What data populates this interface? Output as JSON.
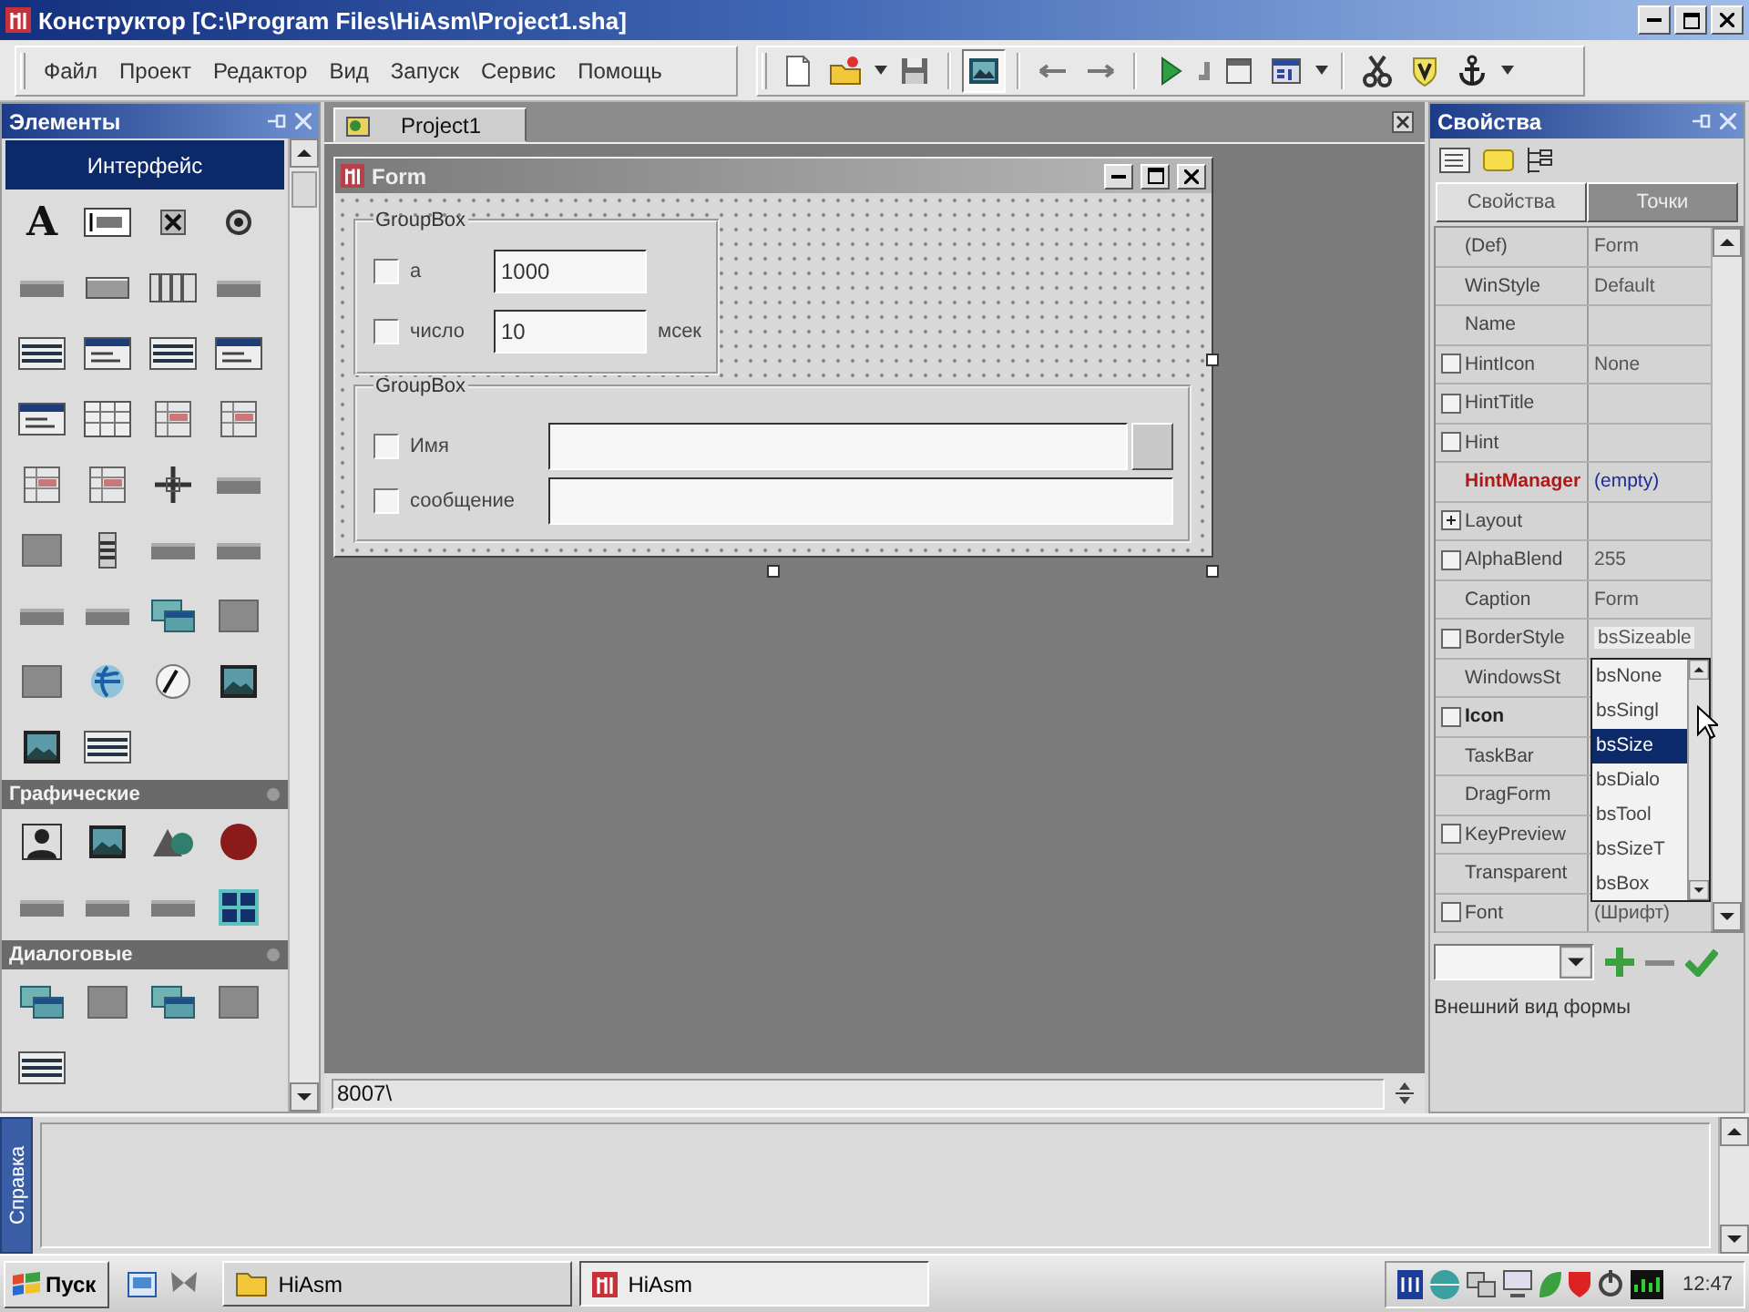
{
  "window": {
    "title": "Конструктор [C:\\Program Files\\HiAsm\\Project1.sha]"
  },
  "menu": [
    "Файл",
    "Проект",
    "Редактор",
    "Вид",
    "Запуск",
    "Сервис",
    "Помощь"
  ],
  "toolbar": [
    {
      "kind": "page",
      "pressed": false
    },
    {
      "kind": "folder",
      "pressed": false
    },
    {
      "kind": "caret",
      "pressed": false
    },
    {
      "kind": "disk",
      "pressed": false
    },
    {
      "kind": "separator"
    },
    {
      "kind": "picture",
      "pressed": true
    },
    {
      "kind": "separator"
    },
    {
      "kind": "leftarrow",
      "pressed": false
    },
    {
      "kind": "rightarrow",
      "pressed": false
    },
    {
      "kind": "separator"
    },
    {
      "kind": "play",
      "pressed": false
    },
    {
      "kind": "stub",
      "pressed": false
    },
    {
      "kind": "form",
      "pressed": false
    },
    {
      "kind": "chart",
      "pressed": false
    },
    {
      "kind": "caret",
      "pressed": false
    },
    {
      "kind": "separator"
    },
    {
      "kind": "scissors",
      "pressed": false
    },
    {
      "kind": "shield",
      "pressed": false
    },
    {
      "kind": "anchor",
      "pressed": false
    },
    {
      "kind": "caret",
      "pressed": false
    }
  ],
  "palette": {
    "title": "Элементы",
    "sections": [
      {
        "title": "Интерфейс",
        "selected": true,
        "items": [
          {
            "kind": "label",
            "glyph": "A"
          },
          {
            "kind": "textbox"
          },
          {
            "kind": "crossbox"
          },
          {
            "kind": "radio"
          },
          {
            "kind": "bar"
          },
          {
            "kind": "button"
          },
          {
            "kind": "columns"
          },
          {
            "kind": "bar"
          },
          {
            "kind": "list"
          },
          {
            "kind": "panel"
          },
          {
            "kind": "list"
          },
          {
            "kind": "panel"
          },
          {
            "kind": "panel"
          },
          {
            "kind": "grid"
          },
          {
            "kind": "table"
          },
          {
            "kind": "table"
          },
          {
            "kind": "table"
          },
          {
            "kind": "table"
          },
          {
            "kind": "crosshair"
          },
          {
            "kind": "bar"
          },
          {
            "kind": "square"
          },
          {
            "kind": "slider"
          },
          {
            "kind": "bar"
          },
          {
            "kind": "bar"
          },
          {
            "kind": "bar"
          },
          {
            "kind": "bar"
          },
          {
            "kind": "windows"
          },
          {
            "kind": "square"
          },
          {
            "kind": "square"
          },
          {
            "kind": "globe"
          },
          {
            "kind": "gauge"
          },
          {
            "kind": "picture"
          },
          {
            "kind": "picture"
          },
          {
            "kind": "list"
          }
        ]
      },
      {
        "title": "Графические",
        "selected": false,
        "items": [
          {
            "kind": "person"
          },
          {
            "kind": "picture"
          },
          {
            "kind": "shapes"
          },
          {
            "kind": "circle"
          },
          {
            "kind": "bar"
          },
          {
            "kind": "bar"
          },
          {
            "kind": "bar"
          },
          {
            "kind": "tiles"
          }
        ]
      },
      {
        "title": "Диалоговые",
        "selected": false,
        "items": [
          {
            "kind": "windows"
          },
          {
            "kind": "square"
          },
          {
            "kind": "windows"
          },
          {
            "kind": "square"
          },
          {
            "kind": "list"
          }
        ]
      }
    ]
  },
  "editor": {
    "tabs": [
      {
        "label": "Project1",
        "selected": true
      }
    ],
    "form": {
      "title": "Form",
      "groups": [
        {
          "title": "GroupBox",
          "rows": [
            {
              "kind": "text",
              "label": "а",
              "value": "1000",
              "checked": false
            },
            {
              "kind": "text",
              "label": "число",
              "value": "10",
              "suffix": "мсек",
              "checked": false
            }
          ]
        },
        {
          "title": "GroupBox",
          "rows": [
            {
              "kind": "browse",
              "label": "Имя",
              "checked": false
            },
            {
              "kind": "text",
              "label": "сообщение",
              "checked": false
            }
          ]
        }
      ]
    },
    "status": "8007\\"
  },
  "properties": {
    "title": "Свойства",
    "tabs": [
      {
        "label": "Свойства",
        "selected": true
      },
      {
        "label": "Точки",
        "selected": false
      }
    ],
    "rows": [
      {
        "kind": "plain",
        "name": "(Def)",
        "value": "Form",
        "bold": false
      },
      {
        "kind": "plain",
        "name": "WinStyle",
        "value": "Default",
        "bold": false
      },
      {
        "kind": "plain",
        "name": "Name",
        "bold": false
      },
      {
        "kind": "checkbox",
        "checked": false,
        "name": "HintIcon",
        "value": "None",
        "bold": false
      },
      {
        "kind": "checkbox",
        "checked": false,
        "name": "HintTitle",
        "bold": false
      },
      {
        "kind": "checkbox",
        "checked": false,
        "name": "Hint",
        "bold": false
      },
      {
        "kind": "link",
        "name": "HintManager",
        "value": "(empty)",
        "bold": true
      },
      {
        "kind": "group",
        "expanded": false,
        "name": "Layout",
        "bold": false
      },
      {
        "kind": "checkbox",
        "checked": false,
        "name": "AlphaBlend",
        "value": "255",
        "bold": false
      },
      {
        "kind": "plain",
        "name": "Caption",
        "value": "Form",
        "bold": false
      },
      {
        "kind": "checkbox",
        "checked": false,
        "name": "BorderStyle",
        "value": "bsSizeable",
        "bold": false
      },
      {
        "kind": "plain",
        "name": "WindowsSt",
        "bold": false
      },
      {
        "kind": "checkbox",
        "checked": false,
        "name": "Icon",
        "bold": true
      },
      {
        "kind": "plain",
        "name": "TaskBar",
        "bold": false
      },
      {
        "kind": "plain",
        "name": "DragForm",
        "bold": false
      },
      {
        "kind": "checkbox",
        "checked": false,
        "name": "KeyPreview",
        "bold": false
      },
      {
        "kind": "plain",
        "name": "Transparent",
        "bold": false
      },
      {
        "kind": "checkbox",
        "checked": false,
        "name": "Font",
        "value": "(Шрифт)",
        "bold": false
      }
    ],
    "dropdown": {
      "items": [
        {
          "label": "bsNone",
          "selected": false
        },
        {
          "label": "bsSingl",
          "selected": false
        },
        {
          "label": "bsSize",
          "selected": true
        },
        {
          "label": "bsDialo",
          "selected": false
        },
        {
          "label": "bsTool",
          "selected": false
        },
        {
          "label": "bsSizeT",
          "selected": false
        },
        {
          "label": "bsBox",
          "selected": false
        }
      ]
    },
    "description": "Внешний вид формы"
  },
  "dock": {
    "tab": "Справка"
  },
  "taskbar": {
    "start": "Пуск",
    "tasks": [
      {
        "kind": "folder",
        "label": "HiAsm",
        "selected": false
      },
      {
        "kind": "app",
        "label": "HiAsm",
        "selected": true
      }
    ],
    "clock": "12:47"
  }
}
